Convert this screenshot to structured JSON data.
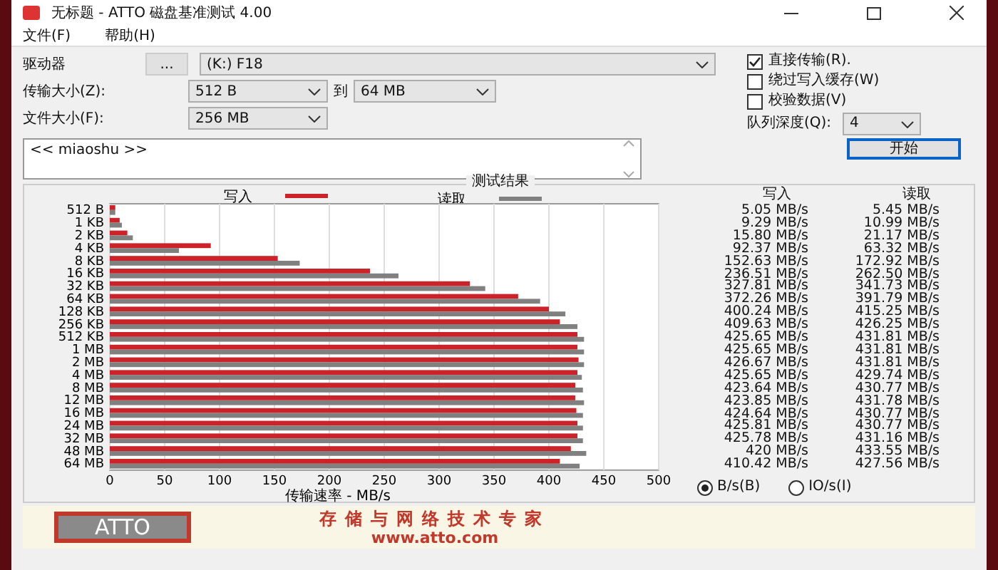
{
  "window": {
    "title": "无标题 - ATTO 磁盘基准测试 4.00"
  },
  "menu": [
    "文件(F)",
    "帮助(H)"
  ],
  "drive": {
    "label": "驱动器",
    "browse": "...",
    "value": "(K:) F18"
  },
  "transfer_size": {
    "label": "传输大小(Z):",
    "from": "512 B",
    "to_label": "到",
    "to": "64 MB"
  },
  "file_size": {
    "label": "文件大小(F):",
    "value": "256 MB"
  },
  "options": [
    {
      "label": "直接传输(R).",
      "checked": true
    },
    {
      "label": "绕过写入缓存(W)",
      "checked": false
    },
    {
      "label": "校验数据(V)",
      "checked": false
    }
  ],
  "queue_depth": {
    "label": "队列深度(Q):",
    "value": "4"
  },
  "start_button": "开始",
  "description": "<< miaoshu >>",
  "results": {
    "title": "测试结果",
    "chart_data": {
      "type": "bar",
      "orientation": "horizontal",
      "grid": true,
      "legend": true,
      "xlabel": "传输速率 - MB/s",
      "xlim": [
        0,
        500
      ],
      "xticks": [
        0,
        50,
        100,
        150,
        200,
        250,
        300,
        350,
        400,
        450,
        500
      ],
      "categories": [
        "512 B",
        "1 KB",
        "2 KB",
        "4 KB",
        "8 KB",
        "16 KB",
        "32 KB",
        "64 KB",
        "128 KB",
        "256 KB",
        "512 KB",
        "1 MB",
        "2 MB",
        "4 MB",
        "8 MB",
        "12 MB",
        "16 MB",
        "24 MB",
        "32 MB",
        "48 MB",
        "64 MB"
      ],
      "series": [
        {
          "name": "写入",
          "color": "#cc2229",
          "values": [
            5,
            9,
            16,
            92,
            153,
            237,
            328,
            372,
            400,
            410,
            426,
            426,
            427,
            426,
            424,
            424,
            425,
            426,
            426,
            420,
            410
          ]
        },
        {
          "name": "读取",
          "color": "#808080",
          "values": [
            5,
            11,
            21,
            63,
            173,
            263,
            342,
            392,
            415,
            426,
            432,
            432,
            432,
            430,
            431,
            432,
            431,
            431,
            431,
            434,
            428
          ]
        }
      ]
    },
    "columns": [
      "写入",
      "读取"
    ],
    "rows": [
      [
        "5.05 MB/s",
        "5.45 MB/s"
      ],
      [
        "9.29 MB/s",
        "10.99 MB/s"
      ],
      [
        "15.80 MB/s",
        "21.17 MB/s"
      ],
      [
        "92.37 MB/s",
        "63.32 MB/s"
      ],
      [
        "152.63 MB/s",
        "172.92 MB/s"
      ],
      [
        "236.51 MB/s",
        "262.50 MB/s"
      ],
      [
        "327.81 MB/s",
        "341.73 MB/s"
      ],
      [
        "372.26 MB/s",
        "391.79 MB/s"
      ],
      [
        "400.24 MB/s",
        "415.25 MB/s"
      ],
      [
        "409.63 MB/s",
        "426.25 MB/s"
      ],
      [
        "425.65 MB/s",
        "431.81 MB/s"
      ],
      [
        "425.65 MB/s",
        "431.81 MB/s"
      ],
      [
        "426.67 MB/s",
        "431.81 MB/s"
      ],
      [
        "425.65 MB/s",
        "429.74 MB/s"
      ],
      [
        "423.64 MB/s",
        "430.77 MB/s"
      ],
      [
        "423.85 MB/s",
        "431.78 MB/s"
      ],
      [
        "424.64 MB/s",
        "430.77 MB/s"
      ],
      [
        "425.81 MB/s",
        "430.77 MB/s"
      ],
      [
        "425.78 MB/s",
        "431.16 MB/s"
      ],
      [
        "420 MB/s",
        "433.55 MB/s"
      ],
      [
        "410.42 MB/s",
        "427.56 MB/s"
      ]
    ]
  },
  "units": [
    {
      "label": "B/s(B)",
      "selected": true
    },
    {
      "label": "IO/s(I)",
      "selected": false
    }
  ],
  "banner": {
    "logo": "ATTO",
    "slogan": "存储与网络技术专家",
    "url": "www.atto.com"
  }
}
